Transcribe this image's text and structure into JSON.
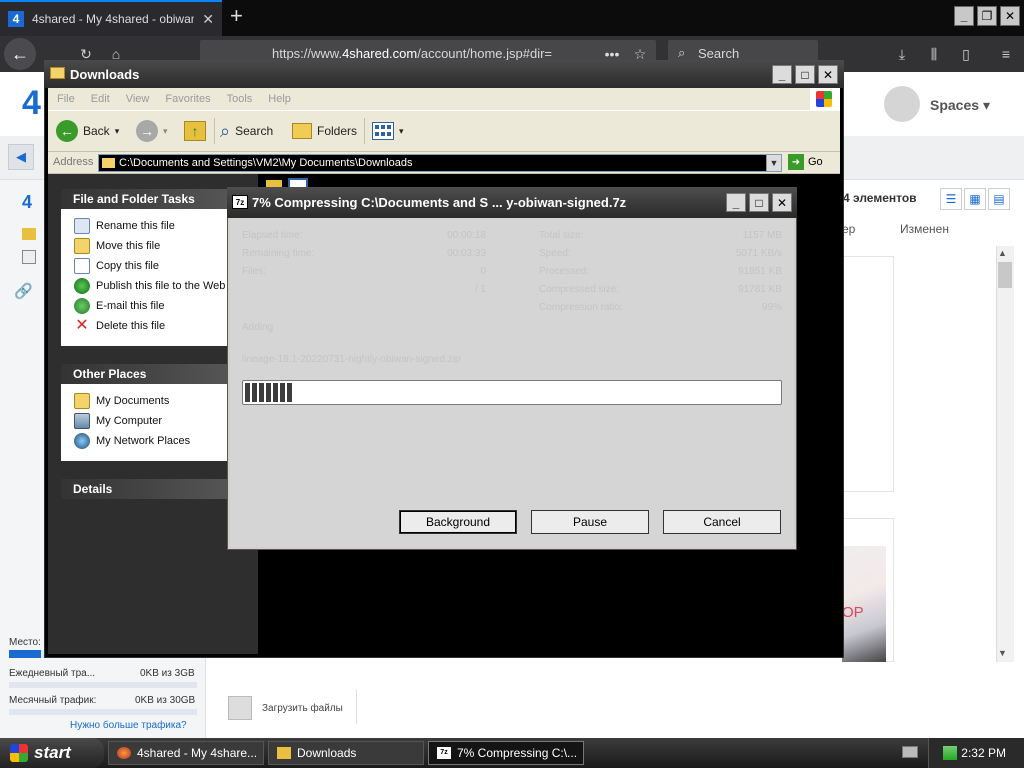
{
  "browser": {
    "tab_title": "4shared - My 4shared - obiwan",
    "url_prefix": "https://www.",
    "url_domain": "4shared.com",
    "url_path": "/account/home.jsp#dir=",
    "search_placeholder": "Search"
  },
  "site": {
    "logo": "4",
    "spaces_label": "Spaces",
    "item_count": "4 элементов",
    "col_header_partial": "ер",
    "col_header_modified": "Изменен",
    "sidebar": {
      "place_label": "Место:",
      "daily_traffic_label": "Ежедневный тра...",
      "daily_traffic_value": "0KB из 3GB",
      "monthly_traffic_label": "Месячный трафик:",
      "monthly_traffic_value": "0KB из 30GB",
      "more_traffic_link": "Нужно больше трафика?",
      "storage_used_fraction": 0.17
    },
    "upload_label": "Загрузить файлы",
    "thumb_text": "OP"
  },
  "explorer": {
    "title": "Downloads",
    "menu": [
      "File",
      "Edit",
      "View",
      "Favorites",
      "Tools",
      "Help"
    ],
    "toolbar": {
      "back": "Back",
      "search": "Search",
      "folders": "Folders"
    },
    "address_label": "Address",
    "address_value": "C:\\Documents and Settings\\VM2\\My Documents\\Downloads",
    "go_label": "Go",
    "file_tasks_header": "File and Folder Tasks",
    "file_tasks": [
      "Rename this file",
      "Move this file",
      "Copy this file",
      "Publish this file to the Web",
      "E-mail this file",
      "Delete this file"
    ],
    "other_places_header": "Other Places",
    "other_places": [
      "My Documents",
      "My Computer",
      "My Network Places"
    ],
    "details_header": "Details"
  },
  "dialog": {
    "title": "7% Compressing C:\\Documents and S ... y-obiwan-signed.7z",
    "icon_label": "7z",
    "stats_left": [
      {
        "label": "Elapsed time:",
        "value": "00:00:18"
      },
      {
        "label": "Remaining time:",
        "value": "00:03:33"
      },
      {
        "label": "Files:",
        "value": "0"
      },
      {
        "label": "",
        "value": "/ 1"
      }
    ],
    "stats_right": [
      {
        "label": "Total size:",
        "value": "1157 MB"
      },
      {
        "label": "Speed:",
        "value": "5071 KB/s"
      },
      {
        "label": "Processed:",
        "value": "91851 KB"
      },
      {
        "label": "Compressed size:",
        "value": "91781 KB"
      },
      {
        "label": "Compression ratio:",
        "value": "99%"
      }
    ],
    "status": "Adding",
    "current_file": "lineage-18.1-20220731-nightly-obiwan-signed.zip",
    "progress_fraction": 0.09,
    "buttons": {
      "background": "Background",
      "pause": "Pause",
      "cancel": "Cancel"
    }
  },
  "taskbar": {
    "start": "start",
    "items": [
      {
        "label": "4shared - My 4share..."
      },
      {
        "label": "Downloads"
      },
      {
        "label": "7% Compressing C:\\..."
      }
    ],
    "clock": "2:32 PM"
  }
}
